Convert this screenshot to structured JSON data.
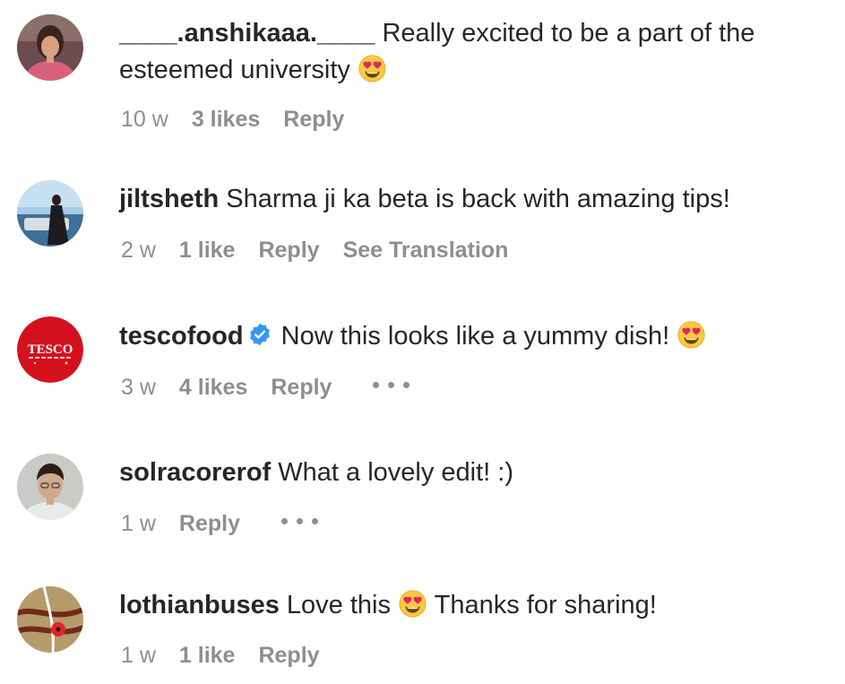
{
  "comments": [
    {
      "username": "____.anshikaaa.____",
      "text_before_emoji": "Really excited to be a part of the esteemed university",
      "emoji": "smiling-face-with-heart-eyes",
      "age": "10 w",
      "likes": "3 likes",
      "reply": "Reply"
    },
    {
      "username": "jiltsheth",
      "text": "Sharma ji ka beta is back with amazing tips!",
      "age": "2 w",
      "likes": "1 like",
      "reply": "Reply",
      "translation": "See Translation"
    },
    {
      "username": "tescofood",
      "verified": true,
      "text_before_emoji": "Now this looks like a yummy dish!",
      "emoji": "smiling-face-with-heart-eyes",
      "avatar_text": "TESCO",
      "age": "3 w",
      "likes": "4 likes",
      "reply": "Reply",
      "more_icon": "ellipsis-icon"
    },
    {
      "username": "solracorerof",
      "text": "What a lovely edit! :)",
      "age": "1 w",
      "reply": "Reply",
      "more_icon": "ellipsis-icon"
    },
    {
      "username": "lothianbuses",
      "text_before_emoji": "Love this",
      "emoji": "smiling-face-with-heart-eyes",
      "text_after_emoji": "Thanks for sharing!",
      "age": "1 w",
      "likes": "1 like",
      "reply": "Reply"
    }
  ],
  "colors": {
    "primary_text": "#262626",
    "secondary_text": "#8e8e8e",
    "verified_badge": "#3897f0",
    "tesco_red": "#d4111e"
  }
}
